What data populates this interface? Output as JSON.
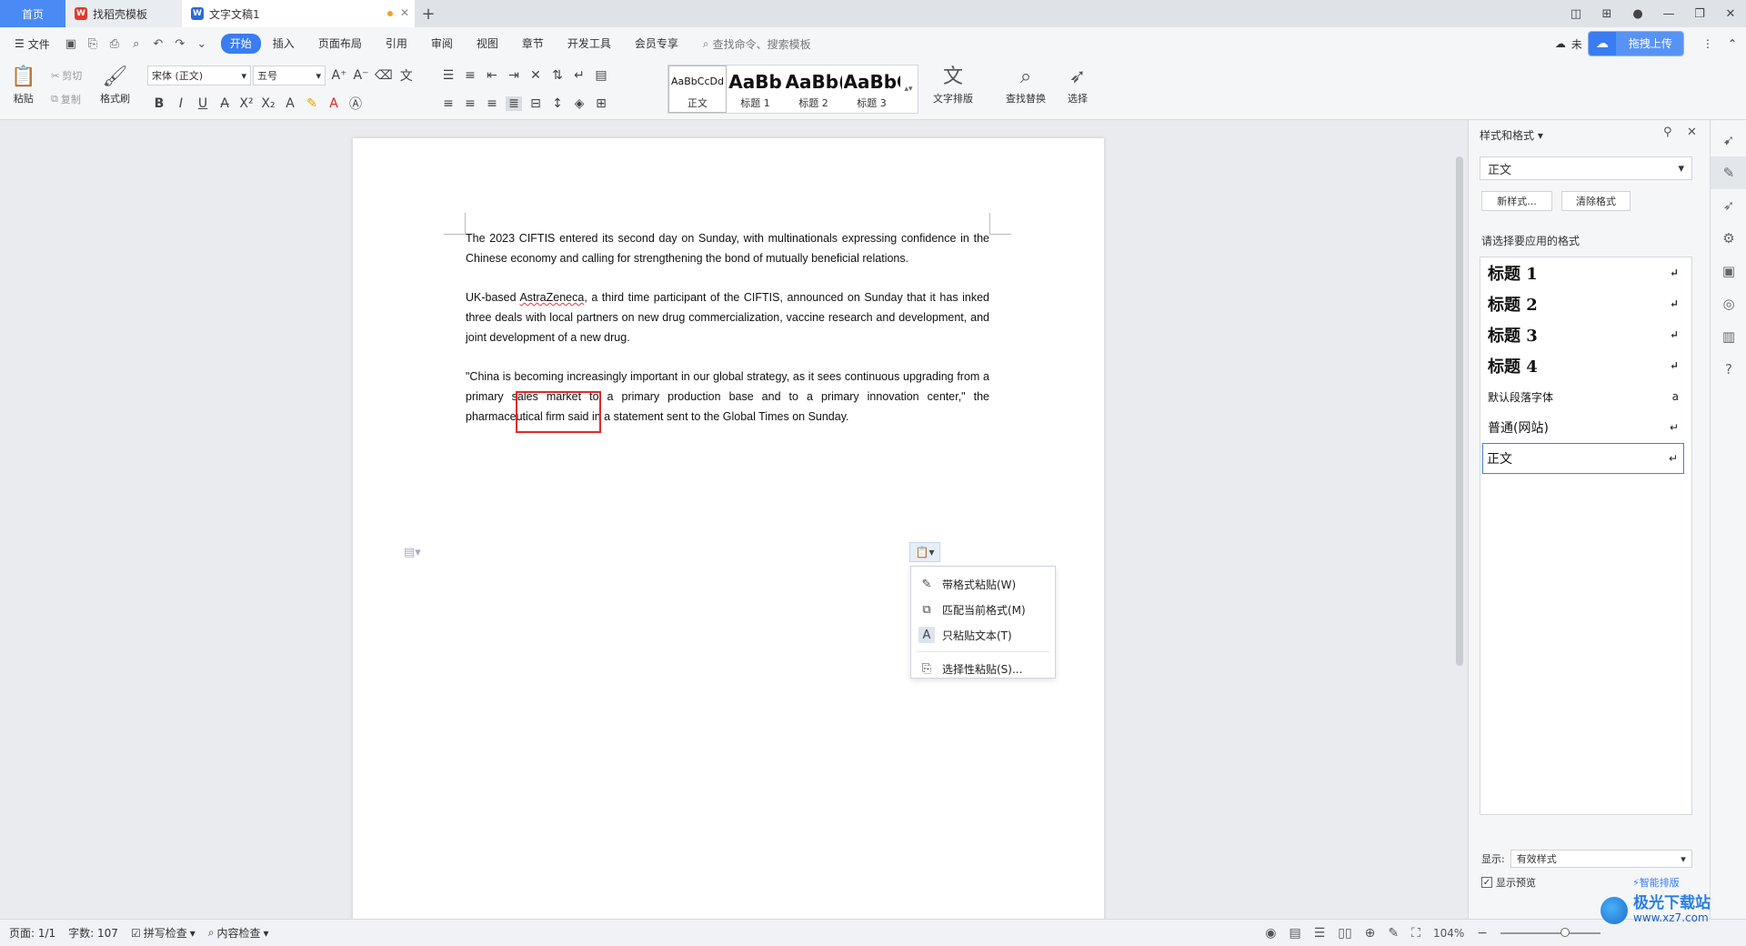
{
  "tabs": {
    "home": "首页",
    "template": "找稻壳模板",
    "document": "文字文稿1",
    "template_logo": "W",
    "document_logo": "W"
  },
  "menubar": {
    "file": "文件",
    "items": [
      "开始",
      "插入",
      "页面布局",
      "引用",
      "审阅",
      "视图",
      "章节",
      "开发工具",
      "会员专享"
    ],
    "active_index": 0,
    "search": "查找命令、搜索模板",
    "cloud_status": "未",
    "upload": "拖拽上传"
  },
  "ribbon": {
    "paste": "粘贴",
    "cut": "剪切",
    "copy": "复制",
    "format_painter": "格式刷",
    "font_name": "宋体 (正文)",
    "font_size": "五号",
    "styles": [
      {
        "sample": "AaBbCcDd",
        "name": "正文"
      },
      {
        "sample": "AaBb",
        "name": "标题 1"
      },
      {
        "sample": "AaBb(",
        "name": "标题 2"
      },
      {
        "sample": "AaBbC(",
        "name": "标题 3"
      }
    ],
    "text_layout": "文字排版",
    "find_replace": "查找替换",
    "select": "选择"
  },
  "document": {
    "p1": "The 2023 CIFTIS entered its second day on Sunday, with multinationals expressing confidence in the Chinese economy and calling for strengthening the bond of mutually beneficial relations.",
    "p2_before": "UK-based ",
    "p2_word": "AstraZeneca",
    "p2_after": ", a third time participant of the CIFTIS, announced on Sunday that it has inked three deals with local partners on new drug commercialization, vaccine research and development, and joint development of a new drug.",
    "p3": "\"China is becoming increasingly important in our global strategy, as it sees continuous upgrading from a primary sales market to a primary production base and to a primary innovation center,\" the pharmaceutical firm said in a statement sent to the Global Times on Sunday."
  },
  "paste_menu": {
    "items": [
      "带格式粘贴(W)",
      "匹配当前格式(M)",
      "只粘贴文本(T)"
    ],
    "special": "选择性粘贴(S)...",
    "highlight_index": 2
  },
  "right_panel": {
    "title": "样式和格式",
    "current_style": "正文",
    "new_style": "新样式...",
    "clear_format": "清除格式",
    "prompt": "请选择要应用的格式",
    "list": [
      {
        "name": "标题  1",
        "kind": "h",
        "mark": "↵"
      },
      {
        "name": "标题  2",
        "kind": "h",
        "mark": "↵"
      },
      {
        "name": "标题  3",
        "kind": "h",
        "mark": "↵"
      },
      {
        "name": "标题  4",
        "kind": "h",
        "mark": "↵"
      },
      {
        "name": "默认段落字体",
        "kind": "s",
        "mark": "a"
      },
      {
        "name": "普通(网站)",
        "kind": "n",
        "mark": "↵"
      },
      {
        "name": "正文",
        "kind": "n",
        "mark": "↵"
      }
    ],
    "selected_index": 6,
    "show_label": "显示:",
    "show_value": "有效样式",
    "preview": "显示预览",
    "preview_checked": true,
    "smart": "智能排版"
  },
  "status": {
    "page": "页面: 1/1",
    "words": "字数: 107",
    "spell": "拼写检查",
    "content": "内容检查",
    "zoom": "104%"
  },
  "watermark": {
    "name": "极光下载站",
    "url": "www.xz7.com"
  }
}
